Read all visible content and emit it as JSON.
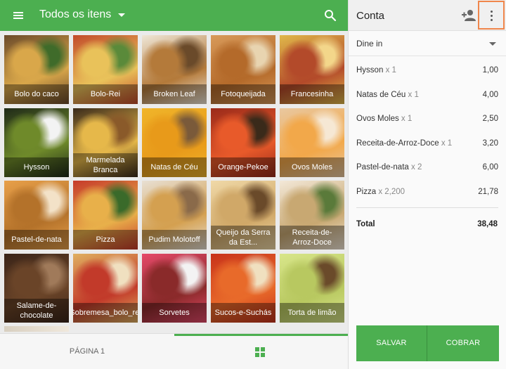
{
  "header": {
    "category": "Todos os itens",
    "menu_icon": "menu-icon",
    "search_icon": "search-icon"
  },
  "items": [
    {
      "label": "Bolo do caco",
      "colors": [
        "#6b4a2a",
        "#d9a74a",
        "#3f6b2a"
      ]
    },
    {
      "label": "Bolo-Rei",
      "colors": [
        "#c24a2a",
        "#e9c25a",
        "#5a8a3a"
      ]
    },
    {
      "label": "Broken Leaf",
      "colors": [
        "#efe7d8",
        "#b47a3a",
        "#6a4a2a"
      ]
    },
    {
      "label": "Fotoqueijada",
      "colors": [
        "#d89a5a",
        "#b46a2a",
        "#e8d4b0"
      ]
    },
    {
      "label": "Francesinha",
      "colors": [
        "#e0b84a",
        "#b34a2a",
        "#f3d68a"
      ]
    },
    {
      "label": "Hysson",
      "colors": [
        "#1f2a18",
        "#6f8a2a",
        "#f3f3f3"
      ]
    },
    {
      "label": "Marmelada Branca",
      "colors": [
        "#3a2a1a",
        "#e6b84a",
        "#8a5a2a"
      ]
    },
    {
      "label": "Natas de Céu",
      "colors": [
        "#f0b52a",
        "#e89a1a",
        "#7a5a3a"
      ]
    },
    {
      "label": "Orange-Pekoe",
      "colors": [
        "#9a2a1a",
        "#e85a2a",
        "#3a2a1a"
      ]
    },
    {
      "label": "Ovos Moles",
      "colors": [
        "#e9c8a0",
        "#f2a84a",
        "#f6e8d4"
      ]
    },
    {
      "label": "Pastel-de-nata",
      "colors": [
        "#e8a04a",
        "#b4722a",
        "#f3e2c8"
      ]
    },
    {
      "label": "Pizza",
      "colors": [
        "#c63a2a",
        "#e8b04a",
        "#3a6a2a"
      ]
    },
    {
      "label": "Pudim Molotoff",
      "colors": [
        "#e8e0d4",
        "#d4a050",
        "#8a6a4a"
      ]
    },
    {
      "label": "Queijo da Serra da Est...",
      "colors": [
        "#f0d9a8",
        "#d0a868",
        "#6a4a2a"
      ]
    },
    {
      "label": "Receita-de-Arroz-Doce",
      "colors": [
        "#f3e8d8",
        "#c8a872",
        "#5a7a3a"
      ]
    },
    {
      "label": "Salame-de-chocolate",
      "colors": [
        "#3a2418",
        "#6a4428",
        "#a07a5a"
      ]
    },
    {
      "label": "Sobremesa_bolo_rei",
      "colors": [
        "#e0b060",
        "#c23a2a",
        "#f0e0c0"
      ]
    },
    {
      "label": "Sorvetes",
      "colors": [
        "#e64a6a",
        "#8a2a2a",
        "#f3f3f3"
      ]
    },
    {
      "label": "Sucos-e-Suchás",
      "colors": [
        "#c8321a",
        "#e86a2a",
        "#f0e0c0"
      ]
    },
    {
      "label": "Torta de limão",
      "colors": [
        "#d8e68a",
        "#b8c860",
        "#6a4a2a"
      ]
    }
  ],
  "footer": {
    "page_label": "PÁGINA 1",
    "grid_icon": "grid-icon"
  },
  "ticket": {
    "title": "Conta",
    "add_customer_icon": "add-person-icon",
    "more_icon": "more-vert-icon",
    "dining_option": "Dine in",
    "orders": [
      {
        "name": "Hysson",
        "qty": "x 1",
        "price": "1,00"
      },
      {
        "name": "Natas de Céu",
        "qty": "x 1",
        "price": "4,00"
      },
      {
        "name": "Ovos Moles",
        "qty": "x 1",
        "price": "2,50"
      },
      {
        "name": "Receita-de-Arroz-Doce",
        "qty": "x 1",
        "price": "3,20"
      },
      {
        "name": "Pastel-de-nata",
        "qty": "x 2",
        "price": "6,00"
      },
      {
        "name": "Pizza",
        "qty": "x 2,200",
        "price": "21,78"
      }
    ],
    "total_label": "Total",
    "total_value": "38,48",
    "save_label": "SALVAR",
    "charge_label": "COBRAR"
  },
  "colors": {
    "accent": "#4caf50",
    "highlight": "#f0864b"
  }
}
